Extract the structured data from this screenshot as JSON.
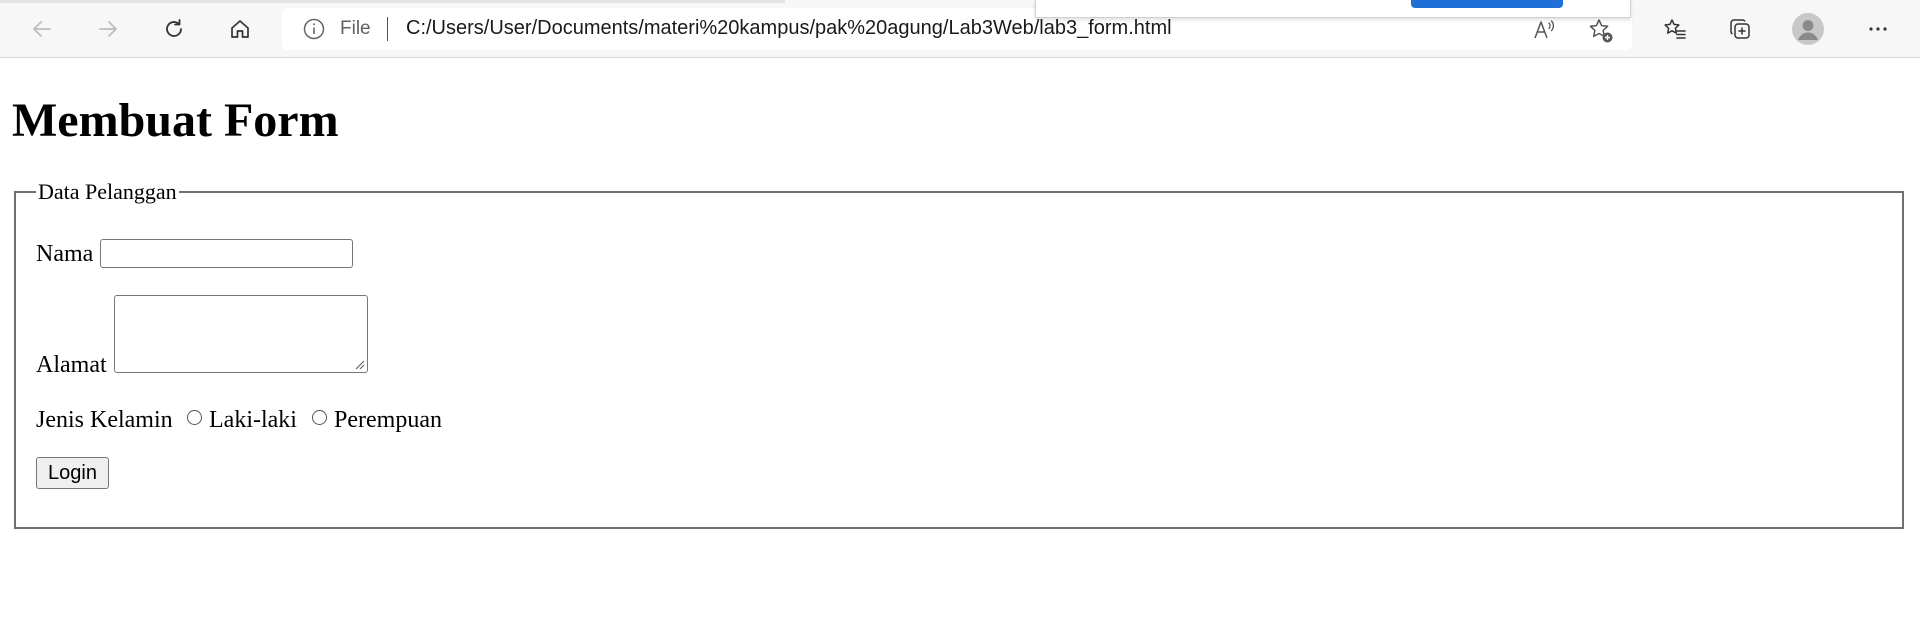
{
  "browser": {
    "address_prefix": "File",
    "url": "C:/Users/User/Documents/materi%20kampus/pak%20agung/Lab3Web/lab3_form.html",
    "icons": {
      "back": "arrow-left-icon",
      "forward": "arrow-right-icon",
      "refresh": "refresh-icon",
      "home": "home-icon",
      "info": "info-icon",
      "read_aloud": "read-aloud-icon",
      "add_favorite": "star-add-icon",
      "favorites": "favorites-list-icon",
      "collections": "collections-icon",
      "profile": "profile-avatar",
      "more": "more-menu-icon"
    }
  },
  "page": {
    "heading": "Membuat Form",
    "fieldset_legend": "Data Pelanggan",
    "fields": {
      "nama_label": "Nama",
      "nama_value": "",
      "alamat_label": "Alamat",
      "alamat_value": "",
      "gender_label": "Jenis Kelamin",
      "gender_options": [
        "Laki-laki",
        "Perempuan"
      ]
    },
    "submit_label": "Login"
  },
  "colors": {
    "accent": "#1f6fd6",
    "fieldset_border": "#707070",
    "toolbar_bg": "#f7f7f7"
  }
}
